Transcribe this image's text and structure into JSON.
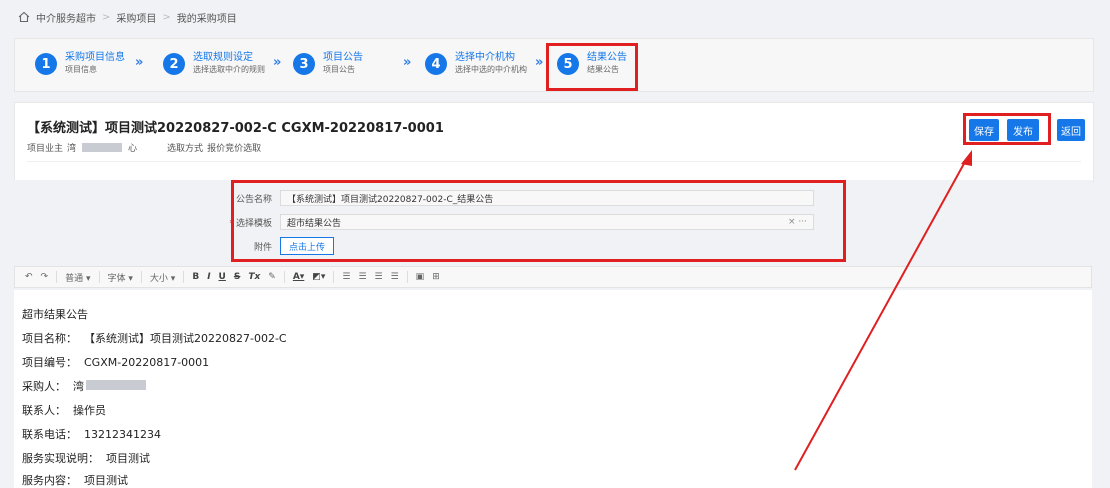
{
  "breadcrumb": [
    "中介服务超市",
    "采购项目",
    "我的采购项目"
  ],
  "steps": [
    {
      "num": "1",
      "title": "采购项目信息",
      "sub": "项目信息"
    },
    {
      "num": "2",
      "title": "选取规则设定",
      "sub": "选择选取中介的规则"
    },
    {
      "num": "3",
      "title": "项目公告",
      "sub": "项目公告"
    },
    {
      "num": "4",
      "title": "选择中介机构",
      "sub": "选择中选的中介机构"
    },
    {
      "num": "5",
      "title": "结果公告",
      "sub": "结果公告"
    }
  ],
  "project": {
    "title": "【系统测试】项目测试20220827-002-C CGXM-20220817-0001",
    "owner_label": "项目业主",
    "owner_prefix": "湾",
    "owner_suffix": "心",
    "method_label": "选取方式",
    "method_value": "报价竞价选取"
  },
  "buttons": {
    "save": "保存",
    "publish": "发布",
    "back": "返回"
  },
  "form": {
    "name_label": "公告名称",
    "name_value": "【系统测试】项目测试20220827-002-C_结果公告",
    "template_label": "选择模板",
    "template_value": "超市结果公告",
    "template_tools": "× ···",
    "attach_label": "附件",
    "upload_label": "点击上传"
  },
  "toolbar": {
    "undo": "↶",
    "redo": "↷",
    "para": "普通",
    "font": "字体",
    "size": "大小",
    "bold": "B",
    "italic": "I",
    "underline": "U",
    "strike": "S",
    "clear": "Tx"
  },
  "content": {
    "heading": "超市结果公告",
    "lines": [
      {
        "label": "项目名称：",
        "value": "【系统测试】项目测试20220827-002-C"
      },
      {
        "label": "项目编号：",
        "value": "CGXM-20220817-0001"
      },
      {
        "label": "采购人：",
        "value": "湾"
      },
      {
        "label": "联系人：",
        "value": "操作员"
      },
      {
        "label": "联系电话：",
        "value": "13212341234"
      },
      {
        "label": "服务实现说明：",
        "value": "项目测试"
      },
      {
        "label": "服务内容：",
        "value": "项目测试"
      }
    ]
  },
  "colors": {
    "accent": "#1677e8",
    "highlight": "#e02020"
  }
}
